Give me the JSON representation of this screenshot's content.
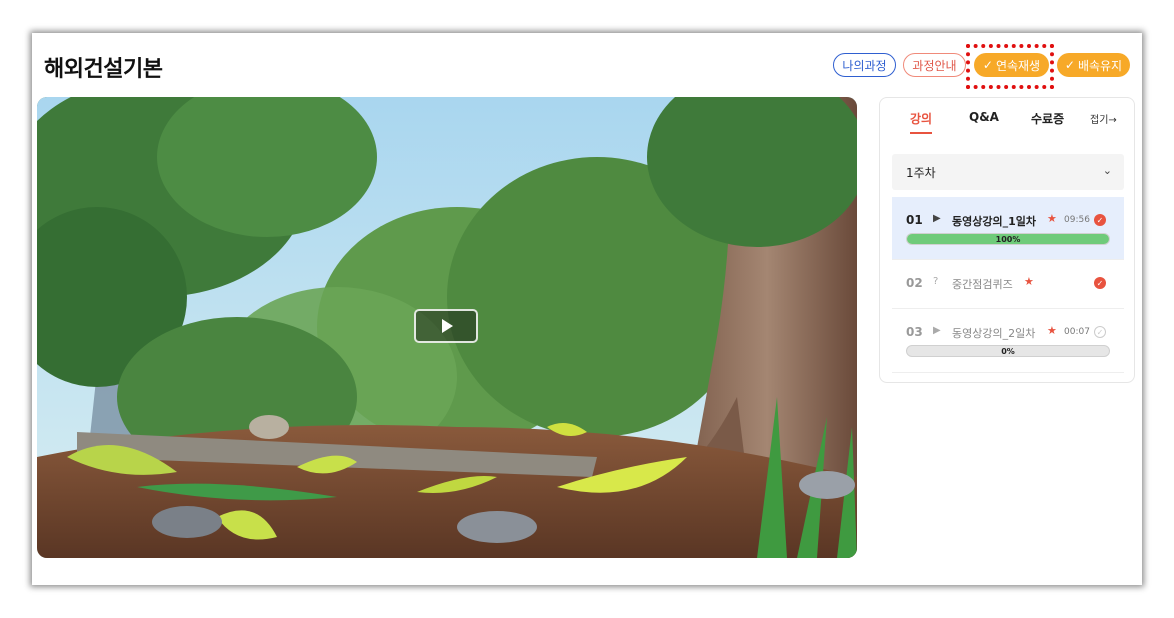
{
  "page": {
    "title": "해외건설기본"
  },
  "header_buttons": {
    "my_course": "나의과정",
    "course_guide": "과정안내",
    "continuous_play": "연속재생",
    "speed_keep": "배속유지",
    "check_glyph": "✓"
  },
  "colors": {
    "accent_orange": "#f7a928",
    "accent_red": "#e8533f",
    "blue_outline": "#2f5fd0",
    "progress_green": "#6fcb7a",
    "active_row_bg": "#e6eefc"
  },
  "player": {
    "play_icon": "play-icon"
  },
  "panel": {
    "tabs": [
      {
        "label": "강의",
        "active": true
      },
      {
        "label": "Q&A",
        "active": false
      },
      {
        "label": "수료증",
        "active": false
      }
    ],
    "fold_label": "접기",
    "fold_arrow": "→",
    "week_label": "1주차",
    "week_chevron": "⌄",
    "lessons": [
      {
        "num": "01",
        "icon": "▶",
        "name": "동영상강의_1일차",
        "star": "★",
        "time": "09:56",
        "done": true,
        "progress": 100,
        "progress_label": "100%"
      },
      {
        "num": "02",
        "icon": "?",
        "name": "중간점검퀴즈",
        "star": "★",
        "time": "",
        "done": true
      },
      {
        "num": "03",
        "icon": "▶",
        "name": "동영상강의_2일차",
        "star": "★",
        "time": "00:07",
        "done": false,
        "progress": 0,
        "progress_label": "0%"
      }
    ]
  }
}
